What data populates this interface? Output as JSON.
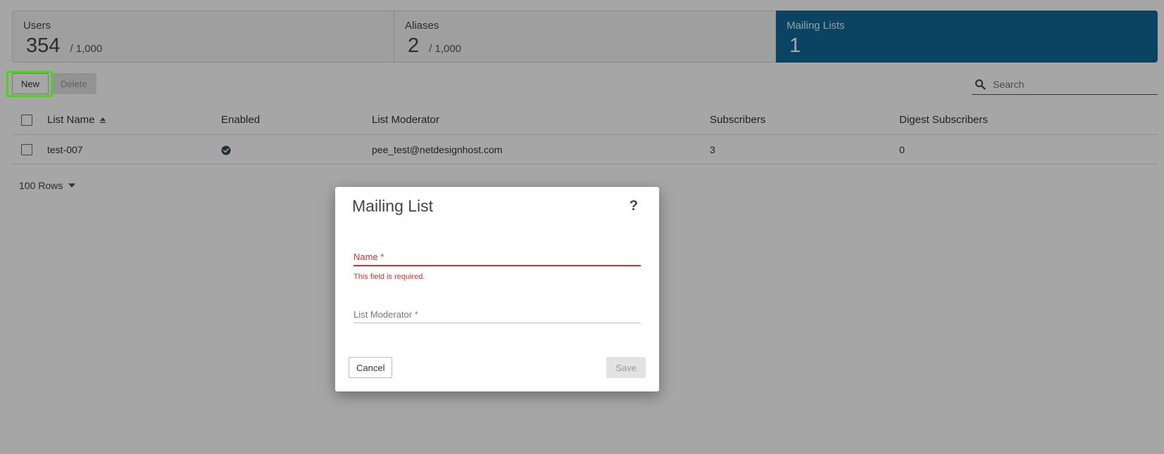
{
  "stats": [
    {
      "label": "Users",
      "count": "354",
      "limit": "/ 1,000"
    },
    {
      "label": "Aliases",
      "count": "2",
      "limit": "/ 1,000"
    },
    {
      "label": "Mailing Lists",
      "count": "1",
      "limit": ""
    }
  ],
  "active_stat": "Mailing Lists",
  "toolbar": {
    "new_label": "New",
    "delete_label": "Delete"
  },
  "search": {
    "placeholder": "Search",
    "value": ""
  },
  "table": {
    "columns": [
      "List Name",
      "Enabled",
      "List Moderator",
      "Subscribers",
      "Digest Subscribers"
    ],
    "sorted_column": "List Name",
    "rows": [
      {
        "list_name": "test-007",
        "enabled": true,
        "list_moderator": "pee_test@netdesignhost.com",
        "subscribers": "3",
        "digest_subscribers": "0"
      }
    ]
  },
  "pagination": {
    "rows_label": "100 Rows"
  },
  "modal": {
    "title": "Mailing List",
    "help_label": "?",
    "name_label": "Name *",
    "name_value": "",
    "name_error": "This field is required.",
    "moderator_label": "List Moderator *",
    "moderator_value": "",
    "cancel_label": "Cancel",
    "save_label": "Save"
  },
  "colors": {
    "active_tab": "#0f6b97",
    "error": "#d32f2f",
    "highlight": "#4fd21c"
  }
}
